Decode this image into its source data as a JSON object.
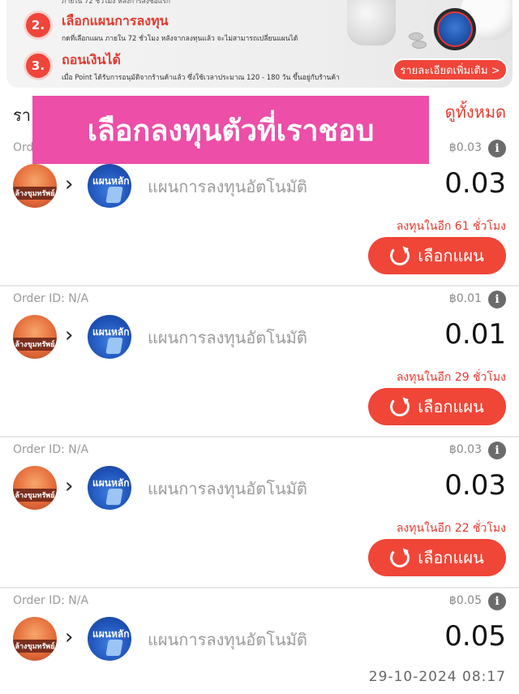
{
  "banner": {
    "step1_tail": "ภายใน 72 ชั่วโมง หลังการลงชื่อแรก",
    "steps": [
      {
        "num": "2.",
        "title": "เลือกแผนการลงทุน",
        "desc": "กดที่เลือกแผน ภายใน 72 ชั่วโมง หลังจากลงทุนแล้ว จะไม่สามารถเปลี่ยนแผนได้"
      },
      {
        "num": "3.",
        "title": "ถอนเงินได้",
        "desc": "เมื่อ Point ได้รับการอนุมัติจากร้านค้าแล้ว ซึ่งใช้เวลาประมาณ 120 - 180 วัน ขึ้นอยู่กับร้านค้า"
      }
    ],
    "details_button": "รายละเอียดเพิ่มเติม >"
  },
  "section": {
    "title": "รา",
    "see_all": "ดูทั้งหมด"
  },
  "overlay": {
    "text": "เลือกลงทุนตัวที่เราชอบ"
  },
  "orders": [
    {
      "order_id": "Order",
      "small_amount": "฿0.03",
      "shop_label": "ล้างขุมทรัพย์",
      "plan_logo": "แผนหลัก",
      "plan_name": "แผนการลงทุนอัตโนมัติ",
      "amount": "0.03",
      "countdown": "ลงทุนในอีก 61 ชั่วโมง",
      "button": "เลือกแผน"
    },
    {
      "order_id": "Order ID: N/A",
      "small_amount": "฿0.01",
      "shop_label": "ล้างขุมทรัพย์",
      "plan_logo": "แผนหลัก",
      "plan_name": "แผนการลงทุนอัตโนมัติ",
      "amount": "0.01",
      "countdown": "ลงทุนในอีก 29 ชั่วโมง",
      "button": "เลือกแผน"
    },
    {
      "order_id": "Order ID: N/A",
      "small_amount": "฿0.03",
      "shop_label": "ล้างขุมทรัพย์",
      "plan_logo": "แผนหลัก",
      "plan_name": "แผนการลงทุนอัตโนมัติ",
      "amount": "0.03",
      "countdown": "ลงทุนในอีก 22 ชั่วโมง",
      "button": "เลือกแผน"
    },
    {
      "order_id": "Order ID: N/A",
      "small_amount": "฿0.05",
      "shop_label": "ล้างขุมทรัพย์",
      "plan_logo": "แผนหลัก",
      "plan_name": "แผนการลงทุนอัตโนมัติ",
      "amount": "0.05"
    }
  ],
  "timestamp": "29-10-2024 08:17",
  "colors": {
    "accent_red": "#ef4638",
    "overlay_pink": "#ec4ea8",
    "muted_text": "#9c9c9c"
  },
  "icons": [
    "info-icon",
    "chevron-right-icon",
    "refresh-icon",
    "shop-avatar",
    "plan-avatar"
  ]
}
